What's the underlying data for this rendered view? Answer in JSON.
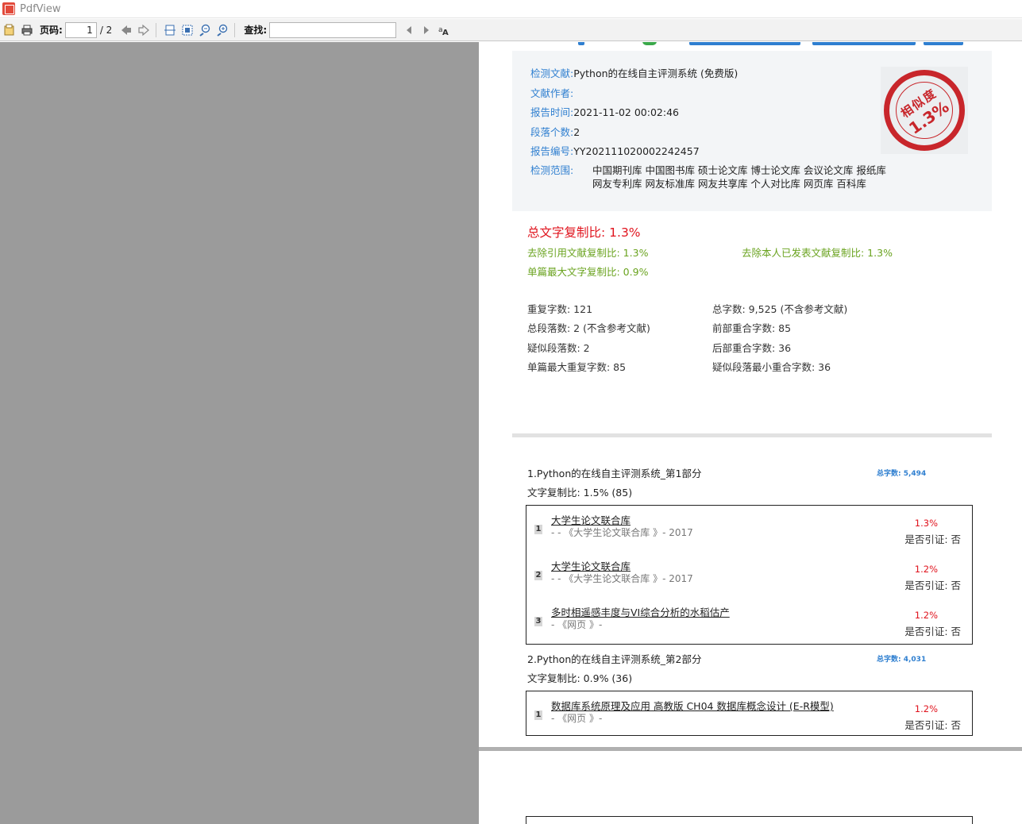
{
  "window": {
    "title": "PdfView"
  },
  "toolbar": {
    "page_label": "页码:",
    "page_value": "1",
    "page_total": "/ 2",
    "find_label": "查找:",
    "find_value": ""
  },
  "report": {
    "info": [
      {
        "key": "检测文献:",
        "value": "Python的在线自主评测系统 (免费版)"
      },
      {
        "key": "文献作者:",
        "value": ""
      },
      {
        "key": "报告时间:",
        "value": "2021-11-02 00:02:46"
      },
      {
        "key": "段落个数:",
        "value": "2"
      },
      {
        "key": "报告编号:",
        "value": "YY202111020002242457"
      }
    ],
    "scope": {
      "key": "检测范围:",
      "line1": "中国期刊库 中国图书库 硕士论文库 博士论文库 会议论文库 报纸库",
      "line2": "网友专利库 网友标准库 网友共享库 个人对比库 网页库 百科库"
    },
    "stamp": {
      "line1": "相似度",
      "line2": "1.3%"
    },
    "total_ratio": "总文字复制比: 1.3%",
    "excl_ref": "去除引用文献复制比: 1.3%",
    "excl_self": "去除本人已发表文献复制比: 1.3%",
    "max_single": "单篇最大文字复制比: 0.9%",
    "stats": {
      "dup_chars": "重复字数: 121",
      "total_chars": "总字数: 9,525 (不含参考文献)",
      "total_paras": "总段落数: 2 (不含参考文献)",
      "front_overlap": "前部重合字数: 85",
      "susp_paras": "疑似段落数: 2",
      "back_overlap": "后部重合字数: 36",
      "max_dup": "单篇最大重复字数: 85",
      "min_overlap": "疑似段落最小重合字数: 36"
    },
    "parts": [
      {
        "title": "1.Python的在线自主评测系统_第1部分",
        "words": "总字数: 5,494",
        "ratio": "文字复制比: 1.5% (85)",
        "sources": [
          {
            "num": "1",
            "title": "大学生论文联合库",
            "meta": "- - 《大学生论文联合库 》- 2017",
            "pct": "1.3%",
            "cite": "是否引证: 否"
          },
          {
            "num": "2",
            "title": "大学生论文联合库",
            "meta": "- - 《大学生论文联合库 》- 2017",
            "pct": "1.2%",
            "cite": "是否引证: 否"
          },
          {
            "num": "3",
            "title": "多时相遥感丰度与VI综合分析的水稻估产",
            "meta": "- 《网页 》-",
            "pct": "1.2%",
            "cite": "是否引证: 否"
          }
        ]
      },
      {
        "title": "2.Python的在线自主评测系统_第2部分",
        "words": "总字数: 4,031",
        "ratio": "文字复制比: 0.9% (36)",
        "sources": [
          {
            "num": "1",
            "title": "数据库系统原理及应用 高教版 CH04 数据库概念设计 (E-R模型)",
            "meta": "- 《网页 》-",
            "pct": "1.2%",
            "cite": "是否引证: 否"
          }
        ]
      }
    ]
  }
}
